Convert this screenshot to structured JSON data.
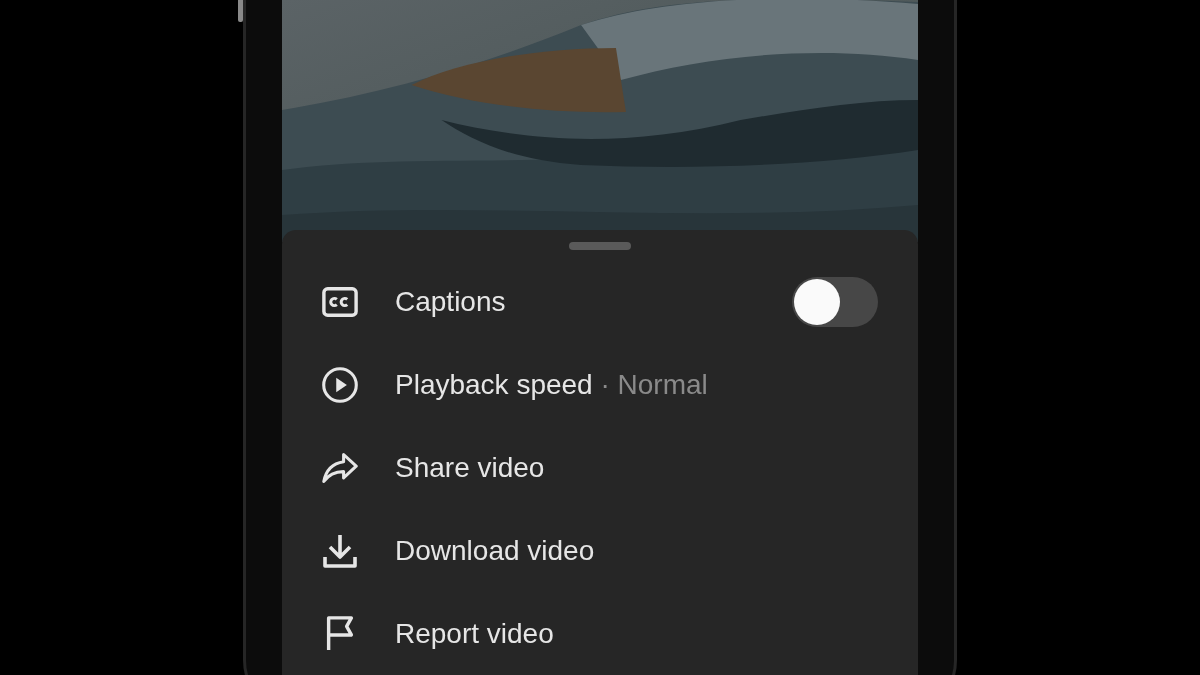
{
  "sheet": {
    "items": [
      {
        "kind": "toggle",
        "label": "Captions",
        "on": false
      },
      {
        "kind": "detail",
        "label": "Playback speed",
        "detail": "· Normal"
      },
      {
        "kind": "plain",
        "label": "Share video"
      },
      {
        "kind": "plain",
        "label": "Download video"
      },
      {
        "kind": "plain",
        "label": "Report video"
      }
    ]
  }
}
